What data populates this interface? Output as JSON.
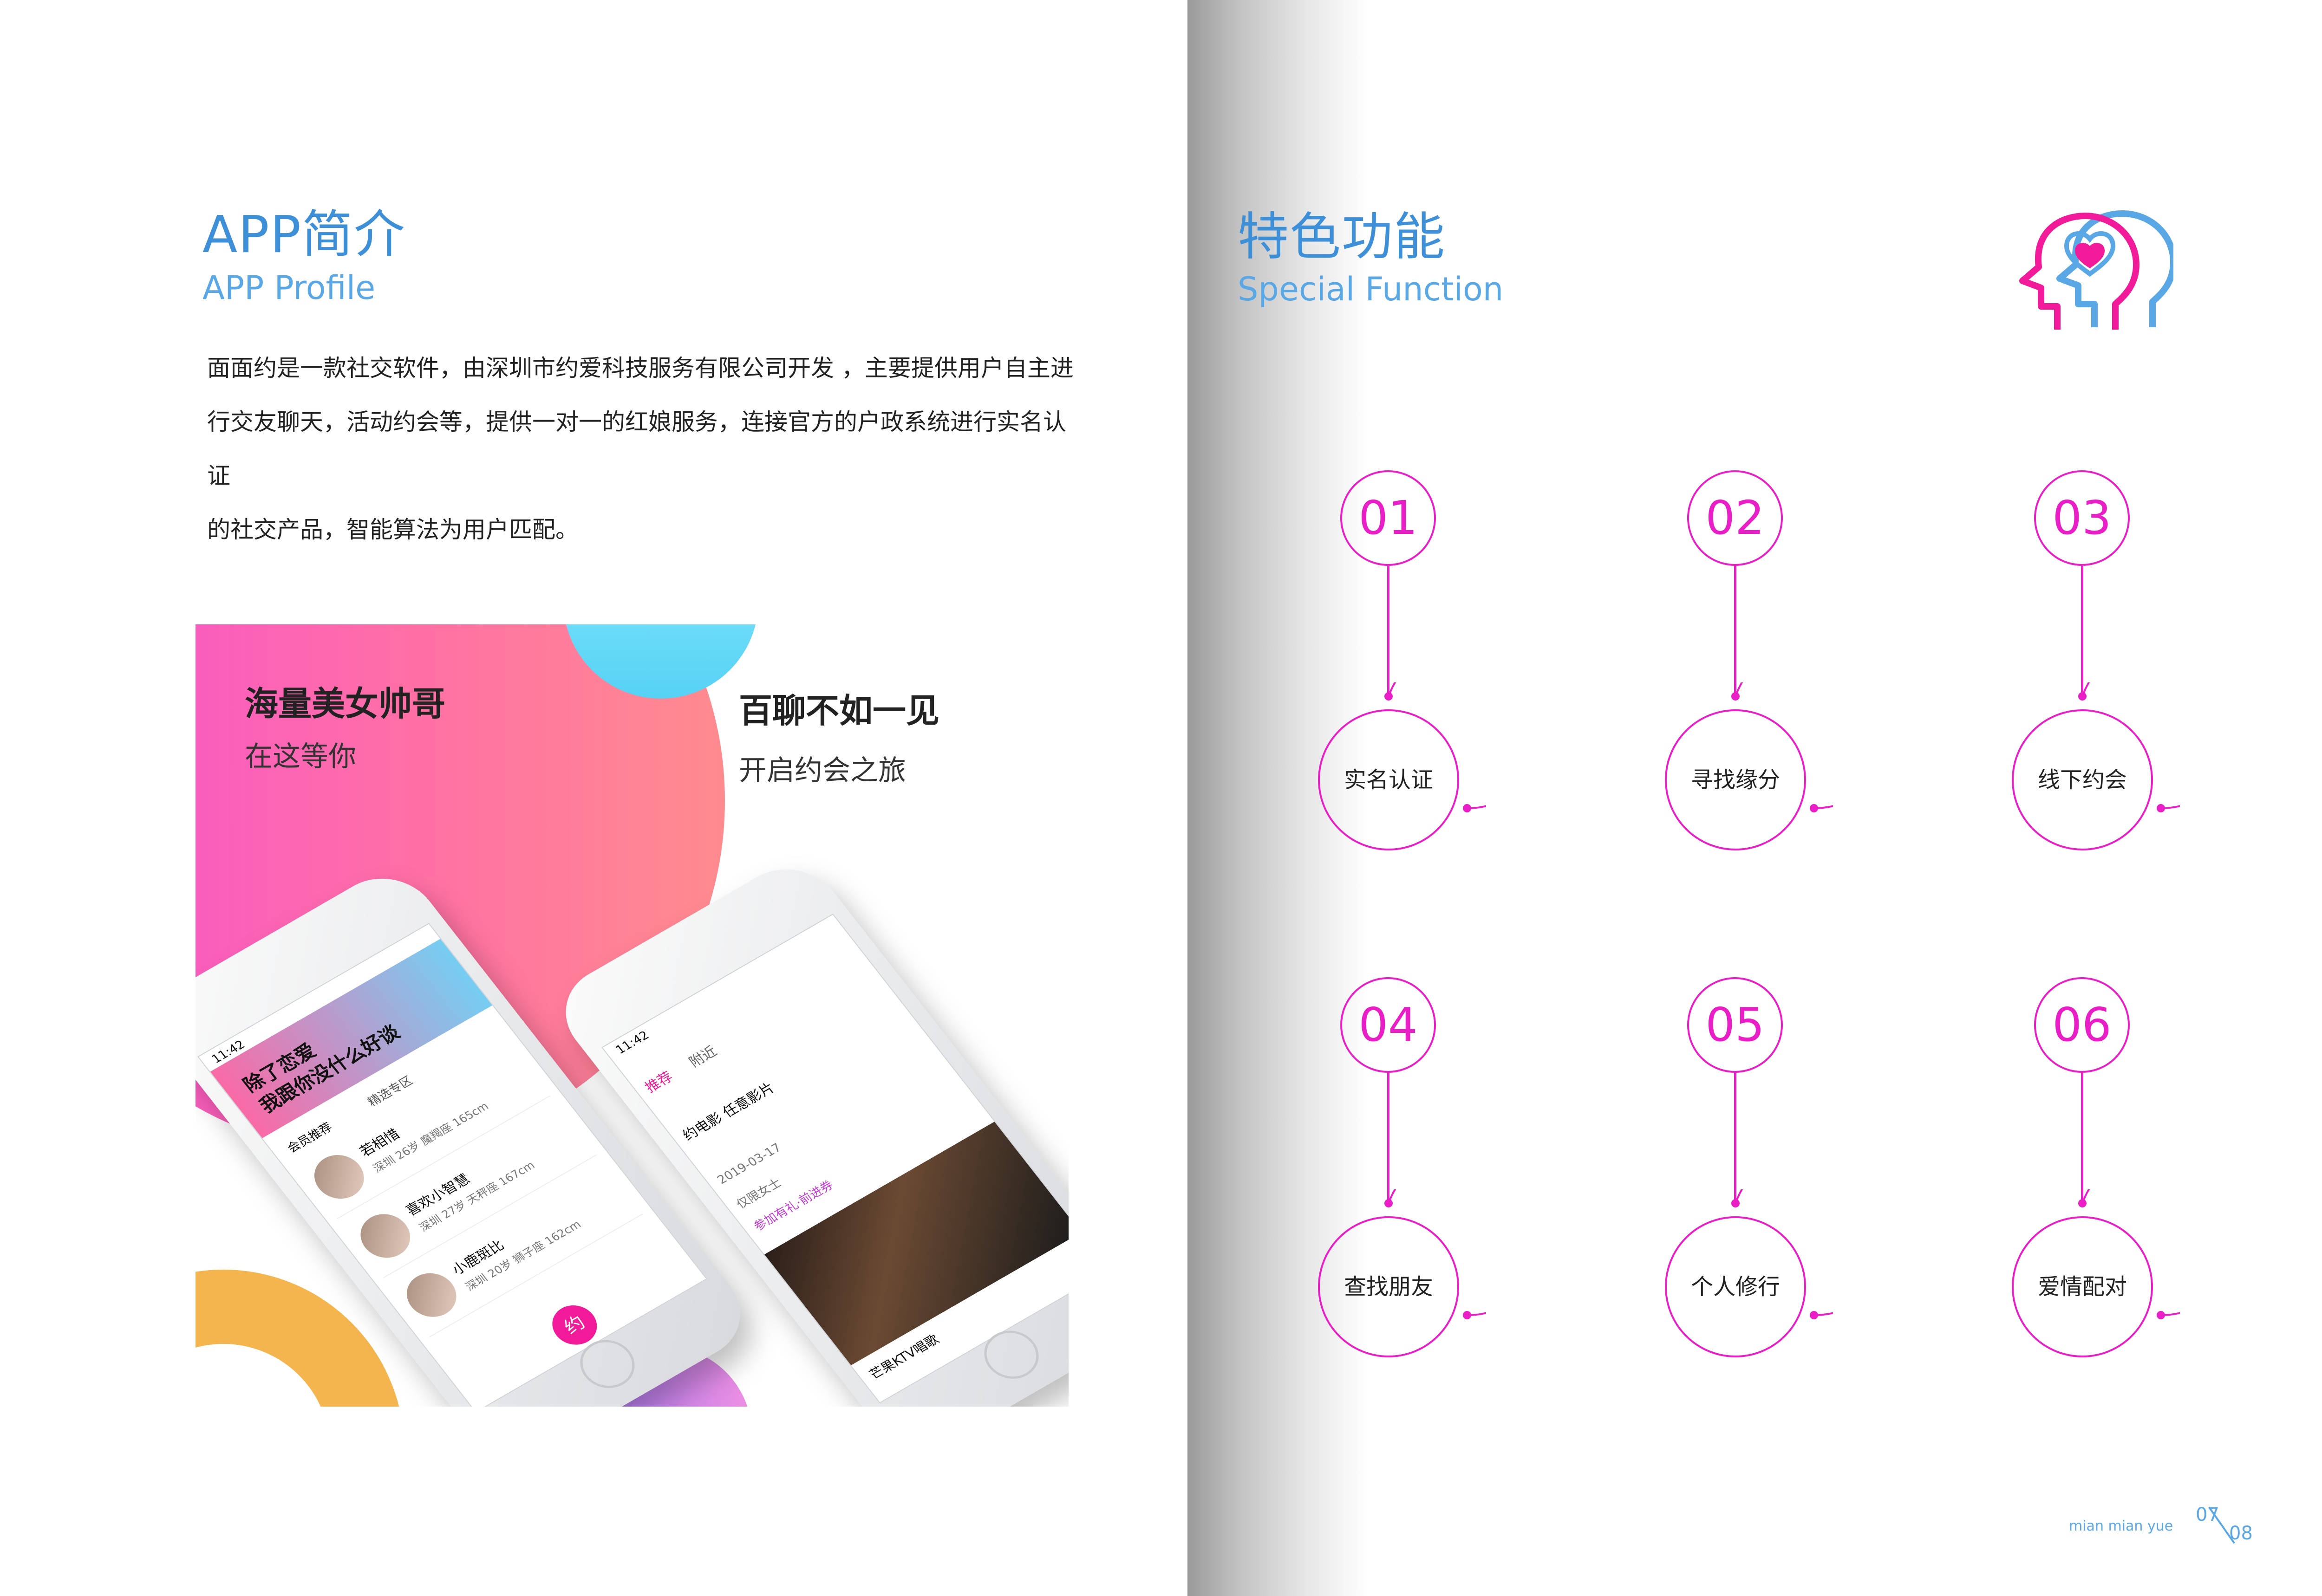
{
  "left": {
    "title_cn": "APP简介",
    "title_en": "APP Profile",
    "intro_lines": [
      "面面约是一款社交软件，由深圳市约爱科技服务有限公司开发 ，主要提供用户自主进",
      "行交友聊天，活动约会等，提供一对一的红娘服务，连接官方的户政系统进行实名认证",
      "的社交产品，智能算法为用户匹配。"
    ],
    "promo": {
      "headline1": "海量美女帅哥",
      "subline1": "在这等你",
      "headline2": "百聊不如一见",
      "subline2": "开启约会之旅",
      "phone1": {
        "status_time": "11:42",
        "banner_line1": "除了恋爱",
        "banner_line2": "我跟你没什么好谈",
        "tabs": [
          "会员推荐",
          "精选专区"
        ],
        "rows": [
          {
            "name": "若相惜",
            "info": "深圳 26岁 魔羯座 165cm"
          },
          {
            "name": "喜欢小智慧",
            "info": "深圳 27岁 天秤座 167cm"
          },
          {
            "name": "小鹿斑比",
            "info": "深圳 20岁 狮子座 162cm"
          }
        ],
        "nav_button": "约"
      },
      "phone2": {
        "status_time": "11:42",
        "chips": [
          "推荐",
          "附近"
        ],
        "event_title": "约电影 任意影片",
        "event_date": "2019-03-17",
        "event_gender": "仅限女士",
        "event_tag": "参加有礼·前进券",
        "event_caption": "芒果KTV唱歌"
      }
    }
  },
  "right": {
    "title_cn": "特色功能",
    "title_en": "Special Function",
    "icon": "head-heart-icon",
    "features": [
      {
        "num": "01",
        "label": "实名认证"
      },
      {
        "num": "02",
        "label": "寻找缘分"
      },
      {
        "num": "03",
        "label": "线下约会"
      },
      {
        "num": "04",
        "label": "查找朋友"
      },
      {
        "num": "05",
        "label": "个人修行"
      },
      {
        "num": "06",
        "label": "爱情配对"
      }
    ],
    "footer": {
      "brand": "mian mian yue",
      "page_current": "07",
      "page_total": "08"
    }
  },
  "colors": {
    "accent_blue": "#3d8fd8",
    "accent_magenta": "#e91ec6",
    "pink_blob": "#f64fd0",
    "cyan_blob": "#56d2f4",
    "orange_arc": "#f5b54e",
    "purple_blob": "#a67cf7"
  }
}
